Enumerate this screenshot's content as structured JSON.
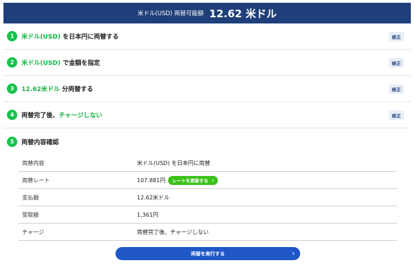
{
  "header": {
    "label": "米ドル(USD) 両替可能額",
    "amount": "12.62 米ドル"
  },
  "steps": [
    {
      "number": "1",
      "highlight": "米ドル(USD)",
      "text": " を日本円に両替する",
      "edit_label": "修正"
    },
    {
      "number": "2",
      "highlight": "米ドル(USD)",
      "text": " で金額を指定",
      "edit_label": "修正"
    },
    {
      "number": "3",
      "highlight": "12.62米ドル",
      "text": " 分両替する",
      "edit_label": "修正"
    },
    {
      "number": "4",
      "text": "両替完了後、",
      "highlight": "チャージしない",
      "edit_label": "修正"
    },
    {
      "number": "5",
      "text": "両替内容確認"
    }
  ],
  "confirm": {
    "rows": [
      {
        "label": "両替内容",
        "value": "米ドル(USD) を日本円に両替"
      },
      {
        "label": "両替レート",
        "value": "107.881円",
        "button": "レートを更新する"
      },
      {
        "label": "支払額",
        "value": "12.62米ドル"
      },
      {
        "label": "受取額",
        "value": "1,361円"
      },
      {
        "label": "チャージ",
        "value": "両替完了後、チャージしない"
      }
    ]
  },
  "execute_button": "両替を実行する",
  "chevron": "›",
  "colors": {
    "header": "#1f3f7a",
    "accent_green": "#17c24d",
    "execute_blue": "#1f56c8"
  }
}
